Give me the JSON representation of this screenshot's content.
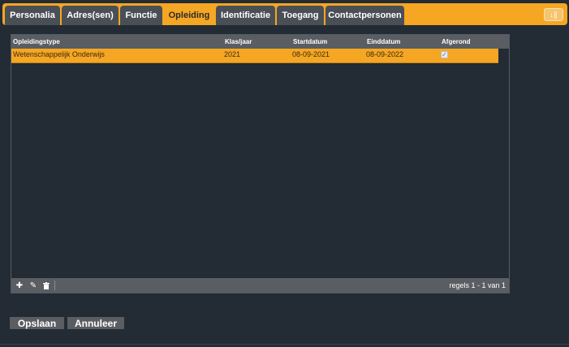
{
  "tabs": [
    {
      "label": "Personalia",
      "active": false
    },
    {
      "label": "Adres(sen)",
      "active": false
    },
    {
      "label": "Functie",
      "active": false
    },
    {
      "label": "Opleiding",
      "active": true
    },
    {
      "label": "Identificatie",
      "active": false
    },
    {
      "label": "Toegang",
      "active": false
    },
    {
      "label": "Contactpersonen",
      "active": false
    }
  ],
  "tab_icon": "download-icon",
  "grid": {
    "columns": [
      "Opleidingstype",
      "Klas/jaar",
      "Startdatum",
      "Einddatum",
      "Afgerond"
    ],
    "rows": [
      {
        "opleidingstype": "Wetenschappelijk Onderwijs",
        "klas_jaar": "2021",
        "startdatum": "08-09-2021",
        "einddatum": "08-09-2022",
        "afgerond": true,
        "selected": true
      }
    ],
    "footer": {
      "add_icon": "plus-icon",
      "edit_icon": "pencil-icon",
      "delete_icon": "trash-icon",
      "pager": "regels 1 - 1 van 1"
    }
  },
  "actions": {
    "save": "Opslaan",
    "cancel": "Annuleer"
  },
  "colors": {
    "accent": "#f5a623",
    "background": "#232b34",
    "header": "#5a5d62"
  }
}
